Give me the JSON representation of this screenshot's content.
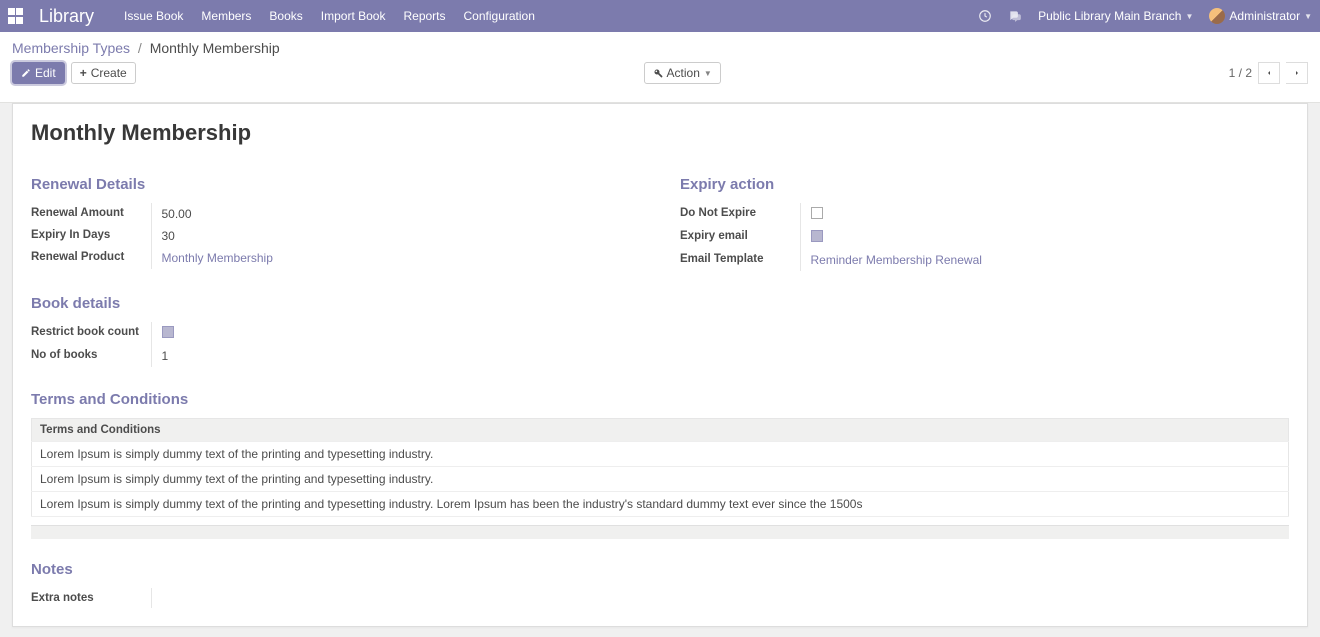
{
  "nav": {
    "brand": "Library",
    "menu": [
      "Issue Book",
      "Members",
      "Books",
      "Import Book",
      "Reports",
      "Configuration"
    ],
    "company": "Public Library Main Branch",
    "user": "Administrator"
  },
  "breadcrumb": {
    "root": "Membership Types",
    "current": "Monthly Membership"
  },
  "toolbar": {
    "edit": "Edit",
    "create": "Create",
    "action": "Action",
    "pager": "1 / 2"
  },
  "page": {
    "title": "Monthly Membership"
  },
  "renewal": {
    "heading": "Renewal Details",
    "amount_label": "Renewal Amount",
    "amount_value": "50.00",
    "expiry_days_label": "Expiry In Days",
    "expiry_days_value": "30",
    "renewal_product_label": "Renewal Product",
    "renewal_product_value": "Monthly Membership"
  },
  "expiry": {
    "heading": "Expiry action",
    "do_not_expire_label": "Do Not Expire",
    "do_not_expire_checked": false,
    "expiry_email_label": "Expiry email",
    "expiry_email_checked": true,
    "email_template_label": "Email Template",
    "email_template_value": "Reminder Membership Renewal"
  },
  "book_details": {
    "heading": "Book details",
    "restrict_label": "Restrict book count",
    "restrict_checked": true,
    "no_books_label": "No of books",
    "no_books_value": "1"
  },
  "terms": {
    "heading": "Terms and Conditions",
    "column": "Terms and Conditions",
    "rows": [
      "Lorem Ipsum is simply dummy text of the printing and typesetting industry.",
      "Lorem Ipsum is simply dummy text of the printing and typesetting industry.",
      "Lorem Ipsum is simply dummy text of the printing and typesetting industry. Lorem Ipsum has been the industry's standard dummy text ever since the 1500s"
    ]
  },
  "notes": {
    "heading": "Notes",
    "extra_label": "Extra notes",
    "extra_value": ""
  }
}
